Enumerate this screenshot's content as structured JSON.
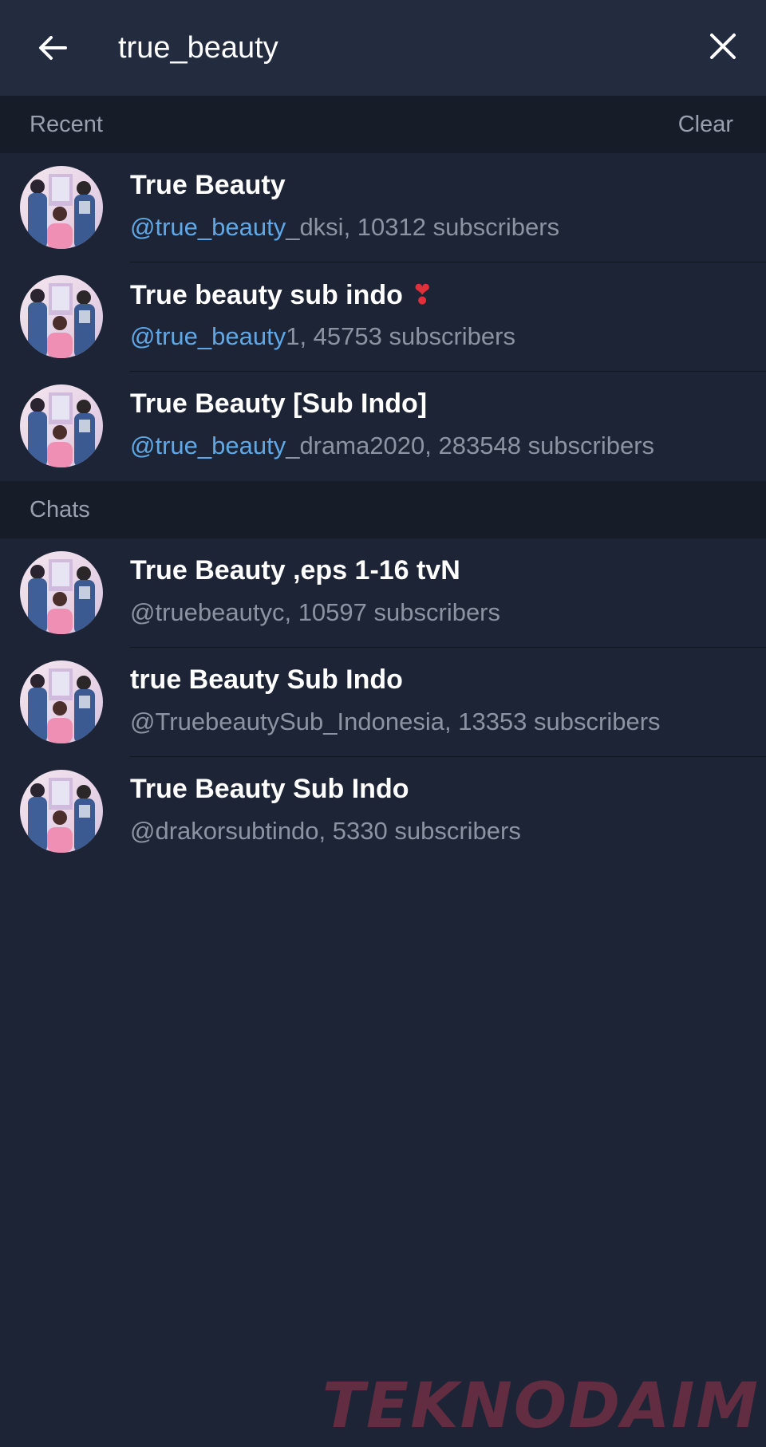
{
  "search": {
    "query": "true_beauty"
  },
  "icons": {
    "back": "arrow-left-icon",
    "close": "close-icon"
  },
  "colors": {
    "highlight": "#5fa8e8",
    "background": "#1d2436",
    "header": "#232b3f",
    "section": "#171c29"
  },
  "recent": {
    "title": "Recent",
    "clear_label": "Clear",
    "items": [
      {
        "title": "True Beauty",
        "handle_match": "@true_beauty",
        "handle_rest": "_dksi",
        "subscribers": ", 10312 subscribers"
      },
      {
        "title": "True beauty sub indo",
        "title_emoji": "❣",
        "handle_match": "@true_beauty",
        "handle_rest": "1",
        "subscribers": ", 45753 subscribers"
      },
      {
        "title": "True Beauty [Sub Indo]",
        "handle_match": "@true_beauty",
        "handle_rest": "_drama2020",
        "subscribers": ", 283548 subscribers"
      }
    ]
  },
  "chats": {
    "title": "Chats",
    "items": [
      {
        "title": "True Beauty ,eps 1-16 tvN",
        "handle": "@truebeautyc",
        "subscribers": ", 10597 subscribers"
      },
      {
        "title": "true Beauty Sub Indo",
        "handle": "@TruebeautySub_Indonesia",
        "subscribers": ", 13353 subscribers"
      },
      {
        "title": "True Beauty Sub Indo",
        "handle": "@drakorsubtindo",
        "subscribers": ", 5330 subscribers"
      }
    ]
  },
  "watermark": "TEKNODAIM"
}
